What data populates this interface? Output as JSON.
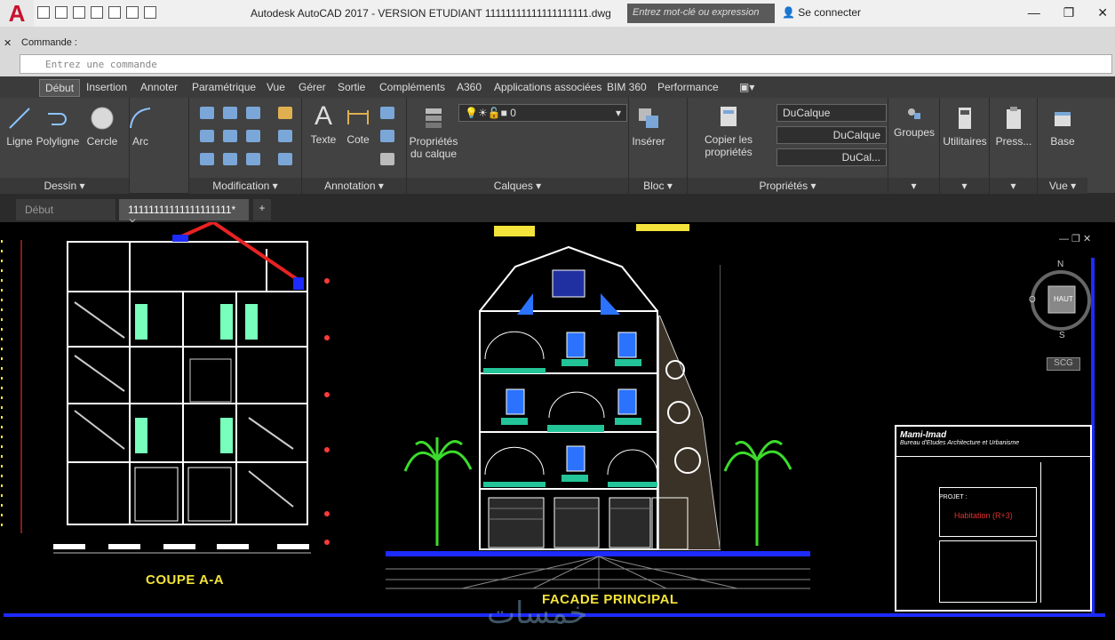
{
  "app": {
    "logo_letter": "A",
    "title": "Autodesk AutoCAD 2017 - VERSION ETUDIANT    11111111111111111111.dwg"
  },
  "search": {
    "placeholder": "Entrez mot-clé ou expression"
  },
  "account": {
    "login_label": "Se connecter"
  },
  "command": {
    "close": "✕",
    "label": "Commande :",
    "placeholder": "Entrez une commande"
  },
  "ribbon_tabs": [
    "Début",
    "Insertion",
    "Annoter",
    "Paramétrique",
    "Vue",
    "Gérer",
    "Sortie",
    "Compléments",
    "A360",
    "Applications associées",
    "BIM 360",
    "Performance"
  ],
  "panels": {
    "dessin": {
      "title": "Dessin",
      "tools": [
        "Ligne",
        "Polyligne",
        "Cercle",
        "Arc"
      ]
    },
    "modification": {
      "title": "Modification"
    },
    "annotation": {
      "title": "Annotation",
      "tools": [
        "Texte",
        "Cote"
      ]
    },
    "calques": {
      "title": "Calques",
      "tool": "Propriétés du calque",
      "layer_value": "0"
    },
    "bloc": {
      "title": "Bloc",
      "tool": "Insérer"
    },
    "proprietes": {
      "title": "Propriétés",
      "tool": "Copier les propriétés",
      "combo1": "DuCalque",
      "combo2": "DuCalque",
      "combo3": "DuCal..."
    },
    "groupes": {
      "title": "Groupes"
    },
    "utilitaires": {
      "title": "Utilitaires"
    },
    "presse": {
      "title": "Press..."
    },
    "base": {
      "title": "Base",
      "foot": "Vue"
    }
  },
  "doc_tabs": {
    "start": "Début",
    "current": "11111111111111111111*",
    "new": "+"
  },
  "drawing": {
    "section_title": "COUPE A-A",
    "facade_title": "FACADE PRINCIPAL",
    "cartouche_header": "Mami-Imad",
    "cartouche_sub": "Bureau d'Etudes Architecture et Urbanisme",
    "project_label": "PROJET :",
    "project_value": "Habitation (R+3)",
    "viewcube": {
      "top": "HAUT",
      "n": "N",
      "s": "S",
      "o": "O",
      "ucs": "SCG"
    }
  },
  "watermark": "خمسات"
}
